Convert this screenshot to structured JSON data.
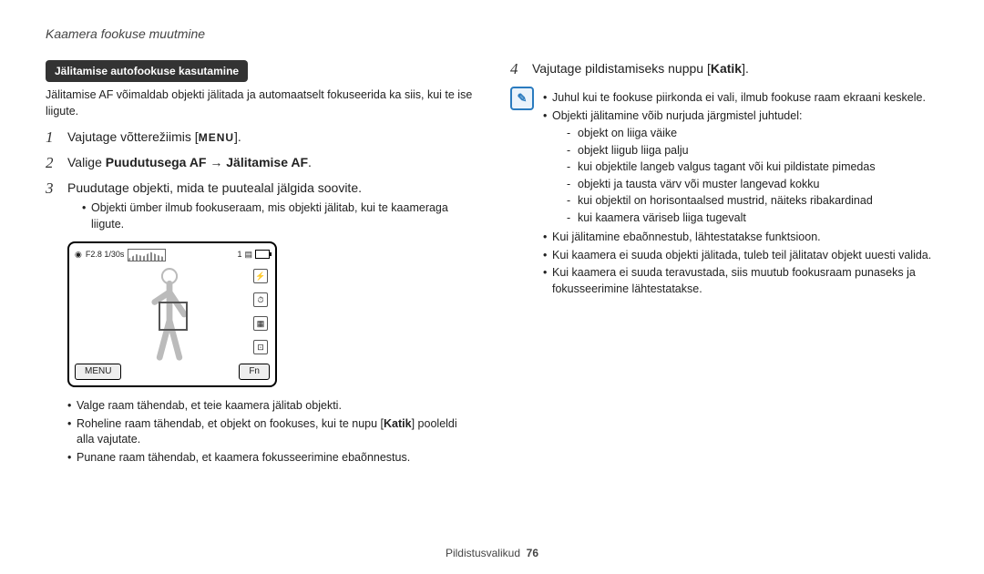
{
  "breadcrumb": "Kaamera fookuse muutmine",
  "left": {
    "section_label": "Jälitamise autofookuse kasutamine",
    "intro": "Jälitamise AF võimaldab objekti jälitada ja automaatselt fokuseerida ka siis, kui te ise liigute.",
    "step1": "Vajutage võtterežiimis [",
    "step1_icon": "MENU",
    "step1_after": "].",
    "step2_pre": "Valige ",
    "step2_b1": "Puudutusega AF",
    "step2_arrow": " → ",
    "step2_b2": "Jälitamise AF",
    "step2_end": ".",
    "step3": "Puudutage objekti, mida te puutealal jälgida soovite.",
    "step3_bullet": "Objekti ümber ilmub fookuseraam, mis objekti jälitab, kui te kaameraga liigute.",
    "lcd": {
      "exposure": "F2.8 1/30s",
      "count": "1",
      "menu": "MENU",
      "fn": "Fn"
    },
    "after_lcd": {
      "b1": "Valge raam tähendab, et teie kaamera jälitab objekti.",
      "b2_pre": "Roheline raam tähendab, et objekt on fookuses, kui te nupu [",
      "b2_bold": "Katik",
      "b2_post": "] pooleldi alla vajutate.",
      "b3": "Punane raam tähendab, et kaamera fokusseerimine ebaõnnestus."
    }
  },
  "right": {
    "step4_pre": "Vajutage pildistamiseks nuppu [",
    "step4_bold": "Katik",
    "step4_post": "].",
    "note_icon": "✎",
    "note": {
      "b1": "Juhul kui te fookuse piirkonda ei vali, ilmub fookuse raam ekraani keskele.",
      "b2": "Objekti jälitamine võib nurjuda järgmistel juhtudel:",
      "d1": "objekt on liiga väike",
      "d2": "objekt liigub liiga palju",
      "d3": "kui objektile langeb valgus tagant või kui pildistate pimedas",
      "d4": "objekti ja tausta värv või muster langevad kokku",
      "d5": "kui objektil on horisontaalsed mustrid, näiteks ribakardinad",
      "d6": "kui kaamera väriseb liiga tugevalt",
      "b3": "Kui jälitamine ebaõnnestub, lähtestatakse funktsioon.",
      "b4": "Kui kaamera ei suuda objekti jälitada, tuleb teil jälitatav objekt uuesti valida.",
      "b5": "Kui kaamera ei suuda teravustada, siis muutub fookusraam punaseks ja fokusseerimine lähtestatakse."
    }
  },
  "footer": {
    "section": "Pildistusvalikud",
    "page": "76"
  }
}
